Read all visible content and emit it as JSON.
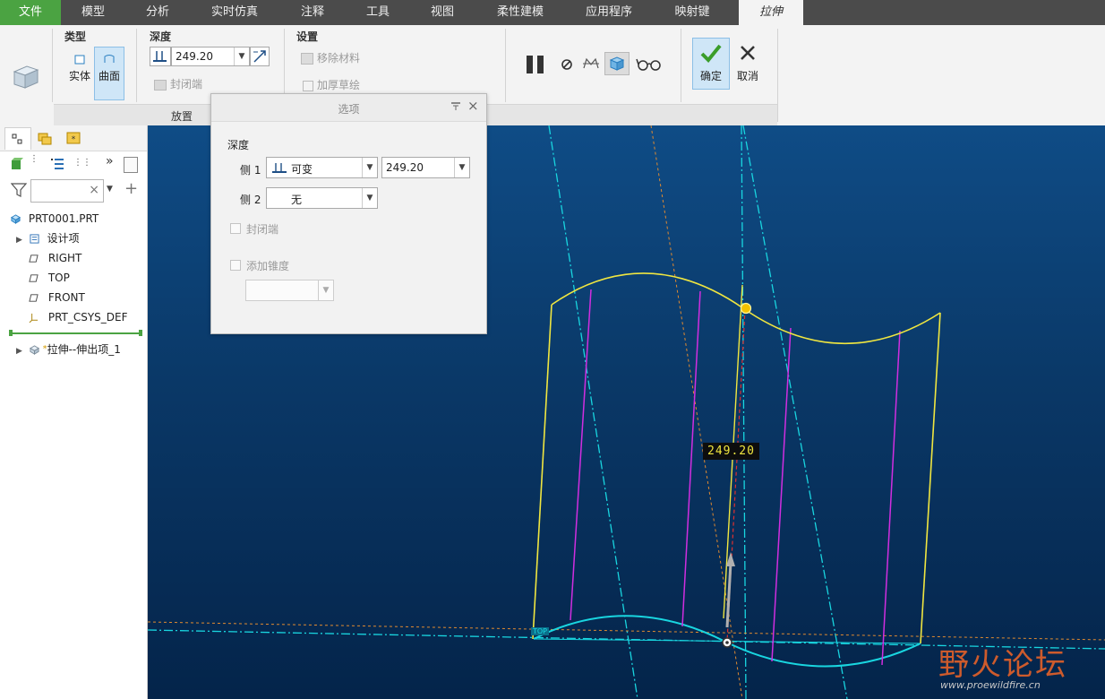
{
  "tabs": [
    "文件",
    "模型",
    "分析",
    "实时仿真",
    "注释",
    "工具",
    "视图",
    "柔性建模",
    "应用程序",
    "映射键",
    "拉伸"
  ],
  "ribbon": {
    "type_group": {
      "title": "类型",
      "solid": "实体",
      "surface": "曲面"
    },
    "depth_group": {
      "title": "深度",
      "value": "249.20",
      "close_ends": "封闭端"
    },
    "settings_group": {
      "title": "设置",
      "remove_material": "移除材料",
      "thicken_sketch": "加厚草绘"
    },
    "placement": "放置",
    "confirm": "确定",
    "cancel": "取消"
  },
  "model_tree": {
    "filter_placeholder": "",
    "root": "PRT0001.PRT",
    "items": [
      "设计项",
      "RIGHT",
      "TOP",
      "FRONT",
      "PRT_CSYS_DEF"
    ],
    "insert_item": "拉伸--伸出项_1"
  },
  "options_dialog": {
    "title": "选项",
    "depth_label": "深度",
    "side1_label": "侧 1",
    "side1_type": "可变",
    "side1_value": "249.20",
    "side2_label": "侧 2",
    "side2_type": "无",
    "close_ends": "封闭端",
    "add_taper": "添加锥度",
    "taper_value": ""
  },
  "graphics": {
    "dimension_value": "249.20",
    "plane_tag": "TOP"
  },
  "watermark": {
    "chars": "野火论坛",
    "url": "www.proewildfire.cn"
  },
  "colors": {
    "file_tab": "#4ba342",
    "sketch_yellow": "#f0e640",
    "datum_cyan": "#19d6e0",
    "magenta": "#d12ee0",
    "confirm_bg": "#cfe6f7"
  }
}
